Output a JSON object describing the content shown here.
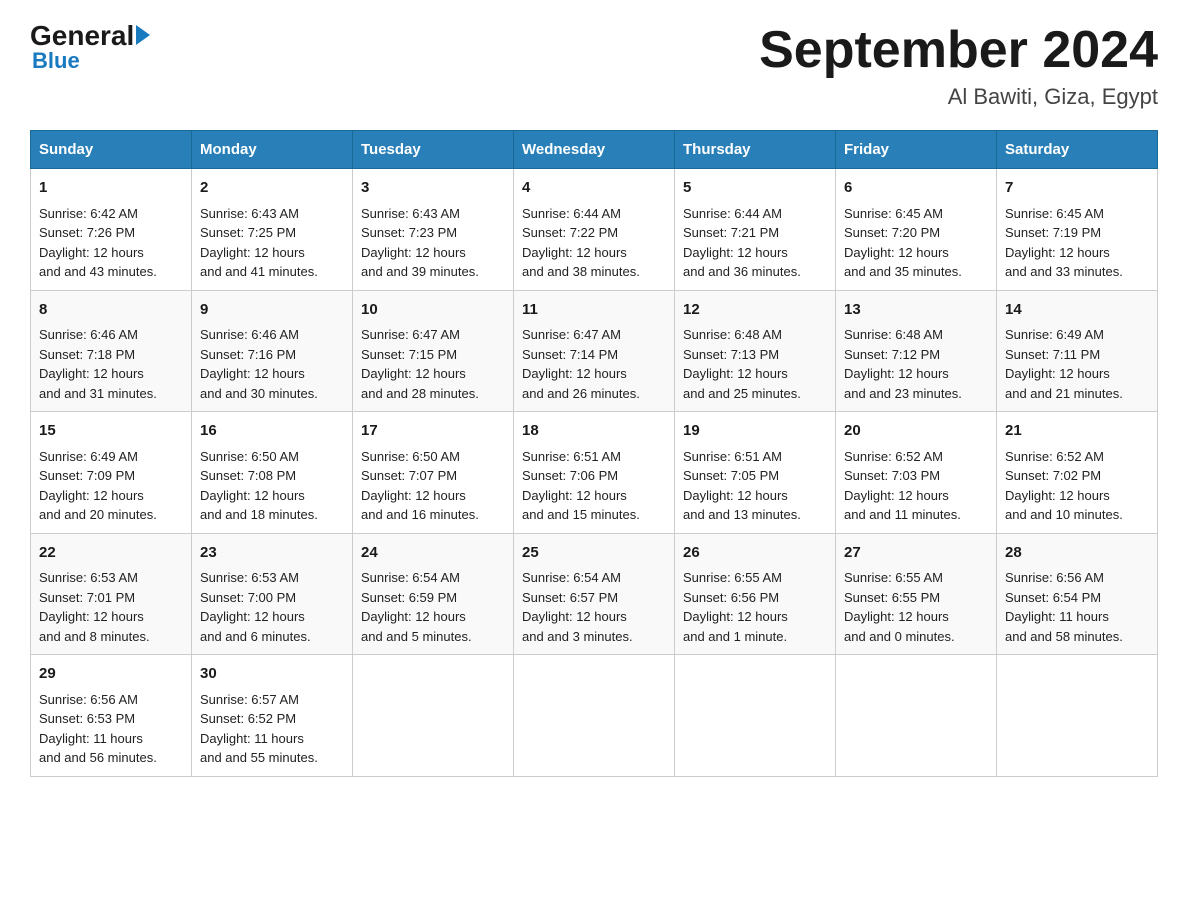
{
  "header": {
    "logo_general": "General",
    "logo_blue": "Blue",
    "month_title": "September 2024",
    "location": "Al Bawiti, Giza, Egypt"
  },
  "weekdays": [
    "Sunday",
    "Monday",
    "Tuesday",
    "Wednesday",
    "Thursday",
    "Friday",
    "Saturday"
  ],
  "weeks": [
    [
      {
        "day": "1",
        "sunrise": "6:42 AM",
        "sunset": "7:26 PM",
        "daylight": "12 hours and 43 minutes."
      },
      {
        "day": "2",
        "sunrise": "6:43 AM",
        "sunset": "7:25 PM",
        "daylight": "12 hours and 41 minutes."
      },
      {
        "day": "3",
        "sunrise": "6:43 AM",
        "sunset": "7:23 PM",
        "daylight": "12 hours and 39 minutes."
      },
      {
        "day": "4",
        "sunrise": "6:44 AM",
        "sunset": "7:22 PM",
        "daylight": "12 hours and 38 minutes."
      },
      {
        "day": "5",
        "sunrise": "6:44 AM",
        "sunset": "7:21 PM",
        "daylight": "12 hours and 36 minutes."
      },
      {
        "day": "6",
        "sunrise": "6:45 AM",
        "sunset": "7:20 PM",
        "daylight": "12 hours and 35 minutes."
      },
      {
        "day": "7",
        "sunrise": "6:45 AM",
        "sunset": "7:19 PM",
        "daylight": "12 hours and 33 minutes."
      }
    ],
    [
      {
        "day": "8",
        "sunrise": "6:46 AM",
        "sunset": "7:18 PM",
        "daylight": "12 hours and 31 minutes."
      },
      {
        "day": "9",
        "sunrise": "6:46 AM",
        "sunset": "7:16 PM",
        "daylight": "12 hours and 30 minutes."
      },
      {
        "day": "10",
        "sunrise": "6:47 AM",
        "sunset": "7:15 PM",
        "daylight": "12 hours and 28 minutes."
      },
      {
        "day": "11",
        "sunrise": "6:47 AM",
        "sunset": "7:14 PM",
        "daylight": "12 hours and 26 minutes."
      },
      {
        "day": "12",
        "sunrise": "6:48 AM",
        "sunset": "7:13 PM",
        "daylight": "12 hours and 25 minutes."
      },
      {
        "day": "13",
        "sunrise": "6:48 AM",
        "sunset": "7:12 PM",
        "daylight": "12 hours and 23 minutes."
      },
      {
        "day": "14",
        "sunrise": "6:49 AM",
        "sunset": "7:11 PM",
        "daylight": "12 hours and 21 minutes."
      }
    ],
    [
      {
        "day": "15",
        "sunrise": "6:49 AM",
        "sunset": "7:09 PM",
        "daylight": "12 hours and 20 minutes."
      },
      {
        "day": "16",
        "sunrise": "6:50 AM",
        "sunset": "7:08 PM",
        "daylight": "12 hours and 18 minutes."
      },
      {
        "day": "17",
        "sunrise": "6:50 AM",
        "sunset": "7:07 PM",
        "daylight": "12 hours and 16 minutes."
      },
      {
        "day": "18",
        "sunrise": "6:51 AM",
        "sunset": "7:06 PM",
        "daylight": "12 hours and 15 minutes."
      },
      {
        "day": "19",
        "sunrise": "6:51 AM",
        "sunset": "7:05 PM",
        "daylight": "12 hours and 13 minutes."
      },
      {
        "day": "20",
        "sunrise": "6:52 AM",
        "sunset": "7:03 PM",
        "daylight": "12 hours and 11 minutes."
      },
      {
        "day": "21",
        "sunrise": "6:52 AM",
        "sunset": "7:02 PM",
        "daylight": "12 hours and 10 minutes."
      }
    ],
    [
      {
        "day": "22",
        "sunrise": "6:53 AM",
        "sunset": "7:01 PM",
        "daylight": "12 hours and 8 minutes."
      },
      {
        "day": "23",
        "sunrise": "6:53 AM",
        "sunset": "7:00 PM",
        "daylight": "12 hours and 6 minutes."
      },
      {
        "day": "24",
        "sunrise": "6:54 AM",
        "sunset": "6:59 PM",
        "daylight": "12 hours and 5 minutes."
      },
      {
        "day": "25",
        "sunrise": "6:54 AM",
        "sunset": "6:57 PM",
        "daylight": "12 hours and 3 minutes."
      },
      {
        "day": "26",
        "sunrise": "6:55 AM",
        "sunset": "6:56 PM",
        "daylight": "12 hours and 1 minute."
      },
      {
        "day": "27",
        "sunrise": "6:55 AM",
        "sunset": "6:55 PM",
        "daylight": "12 hours and 0 minutes."
      },
      {
        "day": "28",
        "sunrise": "6:56 AM",
        "sunset": "6:54 PM",
        "daylight": "11 hours and 58 minutes."
      }
    ],
    [
      {
        "day": "29",
        "sunrise": "6:56 AM",
        "sunset": "6:53 PM",
        "daylight": "11 hours and 56 minutes."
      },
      {
        "day": "30",
        "sunrise": "6:57 AM",
        "sunset": "6:52 PM",
        "daylight": "11 hours and 55 minutes."
      },
      null,
      null,
      null,
      null,
      null
    ]
  ],
  "labels": {
    "sunrise": "Sunrise:",
    "sunset": "Sunset:",
    "daylight": "Daylight:"
  }
}
